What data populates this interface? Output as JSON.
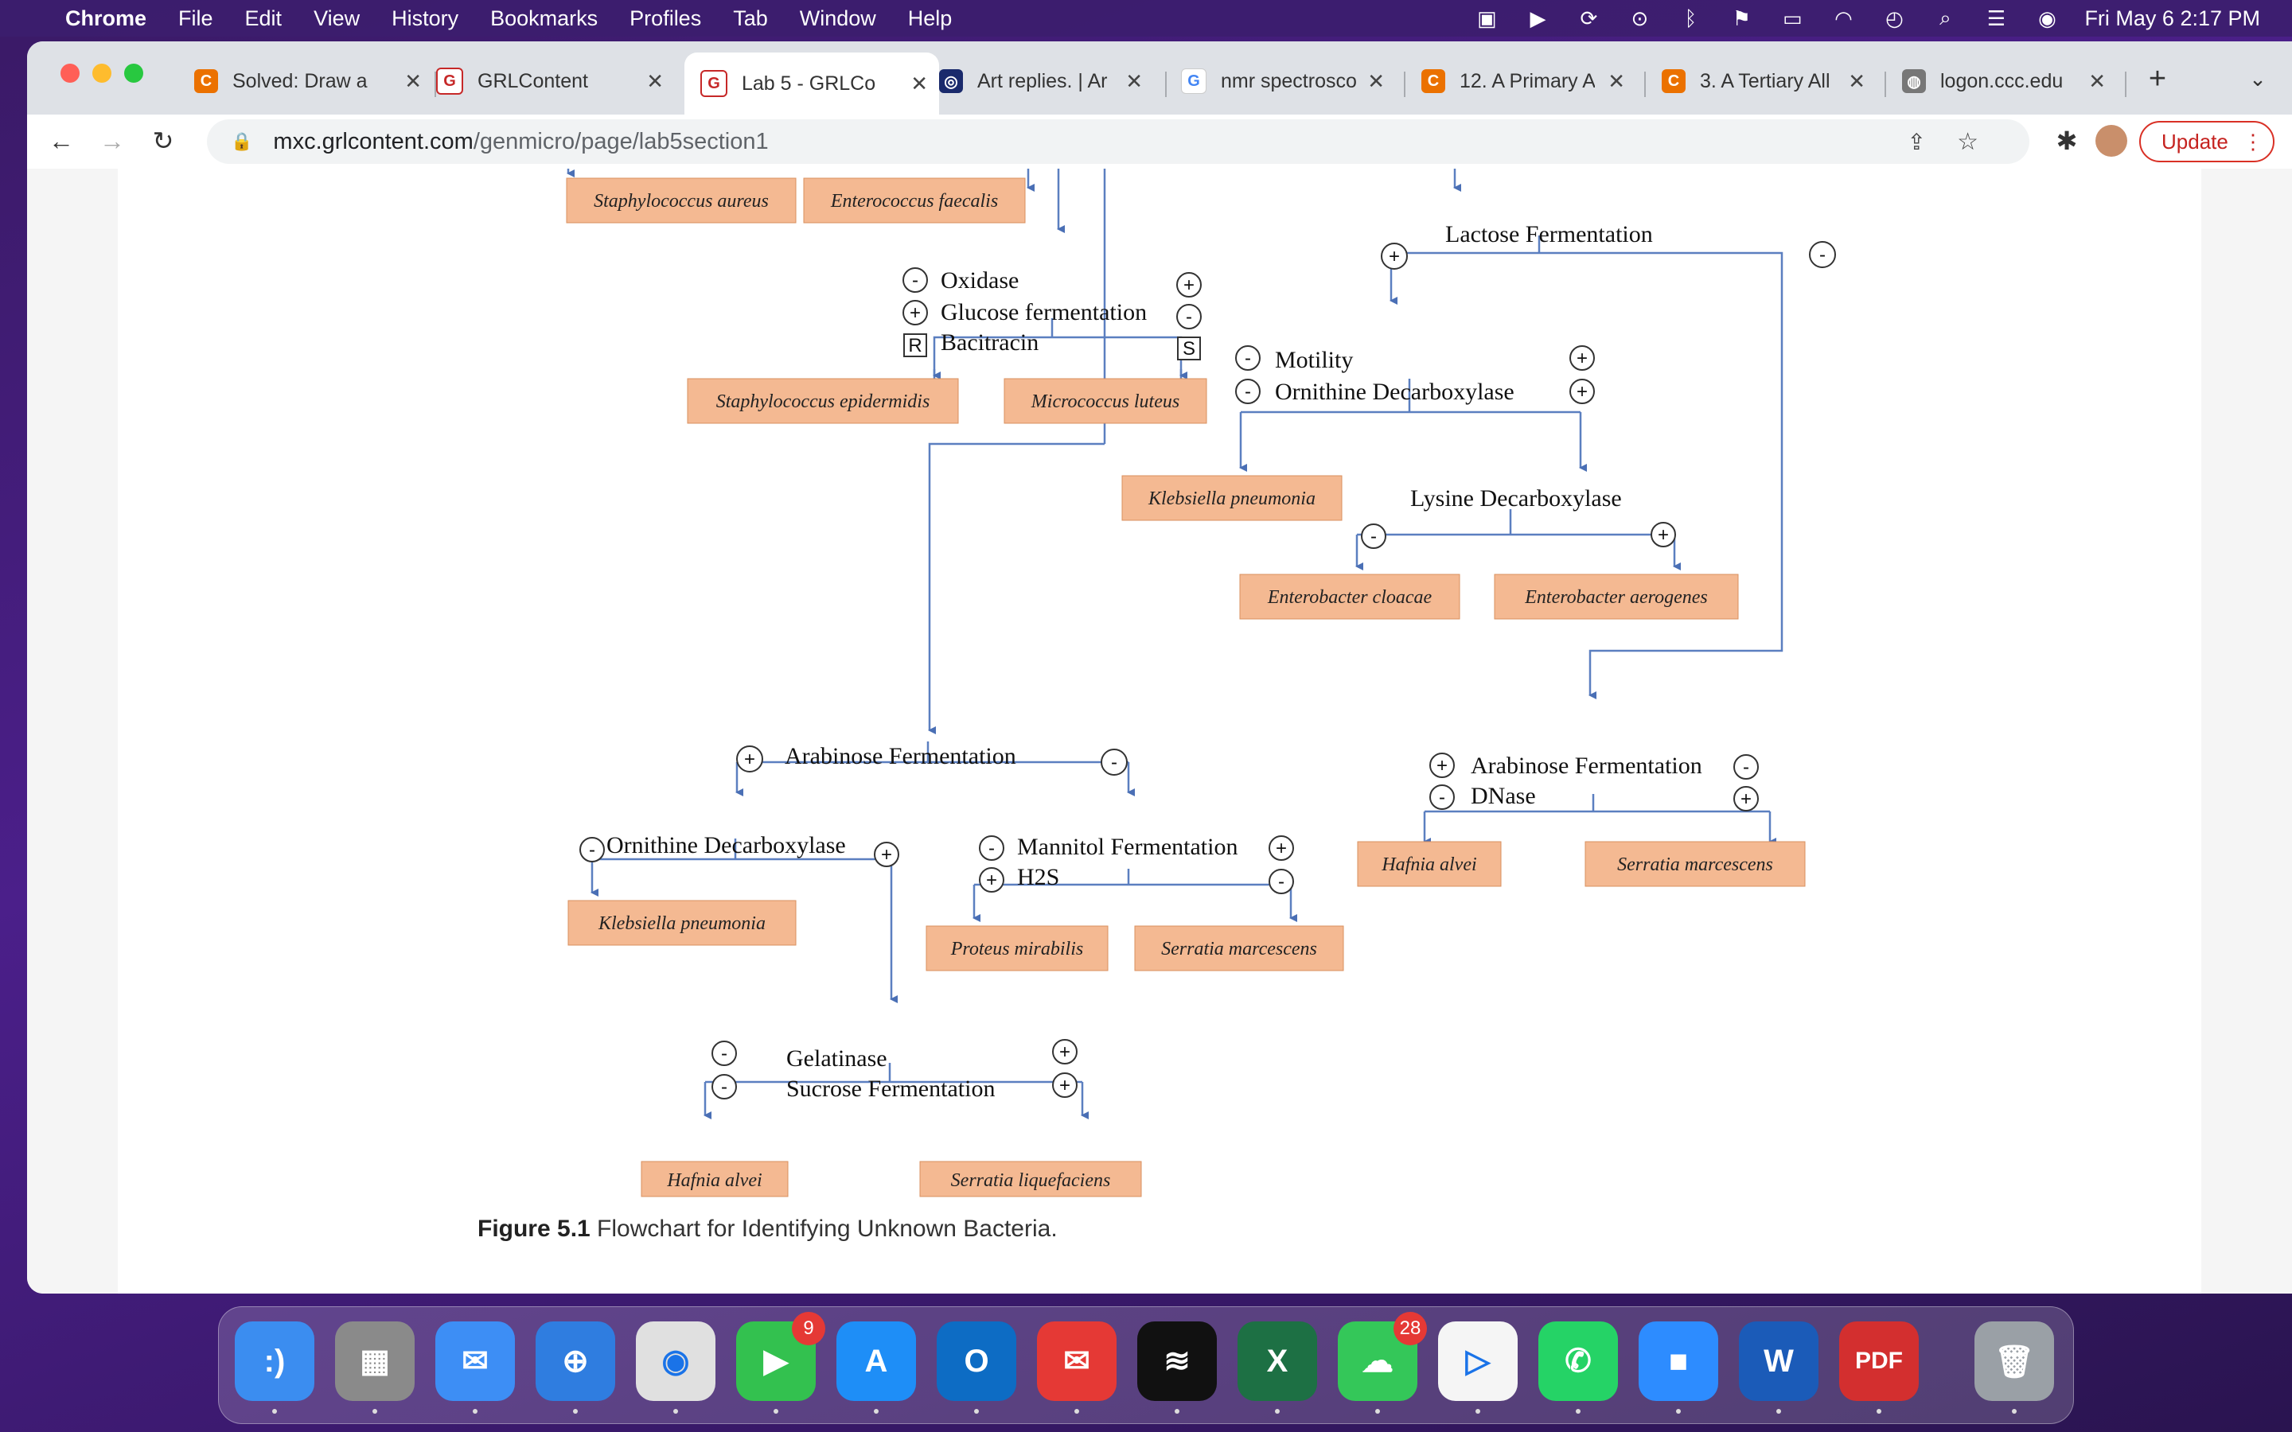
{
  "menubar": {
    "app": "Chrome",
    "items": [
      "File",
      "Edit",
      "View",
      "History",
      "Bookmarks",
      "Profiles",
      "Tab",
      "Window",
      "Help"
    ],
    "clock": "Fri May 6  2:17 PM"
  },
  "tabs": [
    {
      "title": "Solved: Draw a",
      "icon": "chegg-icon"
    },
    {
      "title": "GRLContent",
      "icon": "grl-icon"
    },
    {
      "title": "Lab 5 - GRLCo",
      "icon": "grl-icon",
      "active": true
    },
    {
      "title": "Art replies. | Ar",
      "icon": "globe-icon"
    },
    {
      "title": "nmr spectrosco",
      "icon": "google-icon"
    },
    {
      "title": "12. A Primary A",
      "icon": "chegg-icon"
    },
    {
      "title": "3. A Tertiary All",
      "icon": "chegg-icon"
    },
    {
      "title": "logon.ccc.edu",
      "icon": "globe-icon"
    }
  ],
  "address": {
    "host": "mxc.grlcontent.com",
    "path": "/genmicro/page/lab5section1"
  },
  "update_label": "Update",
  "flowchart": {
    "species": {
      "s_aureus": "Staphylococcus aureus",
      "e_faecalis": "Enterococcus faecalis",
      "s_epidermidis": "Staphylococcus epidermidis",
      "m_luteus": "Micrococcus luteus",
      "k_pneumonia_1": "Klebsiella pneumonia",
      "e_cloacae": "Enterobacter cloacae",
      "e_aerogenes": "Enterobacter aerogenes",
      "h_alvei_1": "Hafnia alvei",
      "s_marcescens_1": "Serratia marcescens",
      "k_pneumonia_2": "Klebsiella pneumonia",
      "p_mirabilis": "Proteus mirabilis",
      "s_marcescens_2": "Serratia marcescens",
      "h_alvei_2": "Hafnia alvei",
      "s_liquefaciens": "Serratia liquefaciens"
    },
    "tests": {
      "oxidase": "Oxidase",
      "glucose": "Glucose fermentation",
      "bacitracin": "Bacitracin",
      "lactose": "Lactose Fermentation",
      "motility": "Motility",
      "ornithine_r": "Ornithine Decarboxylase",
      "lysine": "Lysine Decarboxylase",
      "arabinose_l": "Arabinose Fermentation",
      "arabinose_r": "Arabinose Fermentation",
      "dnase": "DNase",
      "ornithine_l": "Ornithine Decarboxylase",
      "mannitol": "Mannitol Fermentation",
      "h2s": "H2S",
      "gelatinase": "Gelatinase",
      "sucrose": "Sucrose Fermentation"
    },
    "signs": {
      "plus": "+",
      "minus": "-",
      "r": "R",
      "s": "S"
    }
  },
  "caption": {
    "label": "Figure 5.1",
    "text": " Flowchart for Identifying Unknown Bacteria."
  },
  "dock": [
    {
      "name": "finder",
      "color": "#3b8df0",
      "glyph": ":)"
    },
    {
      "name": "launchpad",
      "color": "#8a8a8a",
      "glyph": "▦"
    },
    {
      "name": "mail",
      "color": "#3d8ef5",
      "glyph": "✉"
    },
    {
      "name": "safari",
      "color": "#2f7de0",
      "glyph": "⊕"
    },
    {
      "name": "chrome",
      "color": "#e0e0e0",
      "glyph": "◉"
    },
    {
      "name": "facetime",
      "color": "#33c14f",
      "glyph": "▶",
      "badge": "9"
    },
    {
      "name": "app-store",
      "color": "#1e8ef7",
      "glyph": "A"
    },
    {
      "name": "outlook",
      "color": "#0d6cc4",
      "glyph": "O"
    },
    {
      "name": "email",
      "color": "#e53935",
      "glyph": "✉"
    },
    {
      "name": "spotify",
      "color": "#111111",
      "glyph": "≋"
    },
    {
      "name": "excel",
      "color": "#1d7044",
      "glyph": "X"
    },
    {
      "name": "messages",
      "color": "#34c759",
      "glyph": "☁",
      "badge": "28"
    },
    {
      "name": "google-play",
      "color": "#f5f5f5",
      "glyph": "▷"
    },
    {
      "name": "whatsapp",
      "color": "#25d366",
      "glyph": "✆"
    },
    {
      "name": "zoom",
      "color": "#2d8cff",
      "glyph": "■"
    },
    {
      "name": "word",
      "color": "#1b5bb8",
      "glyph": "W"
    },
    {
      "name": "pdf",
      "color": "#d32f2f",
      "glyph": "PDF"
    },
    {
      "name": "trash",
      "color": "#9aa0a6",
      "glyph": "🗑"
    }
  ]
}
